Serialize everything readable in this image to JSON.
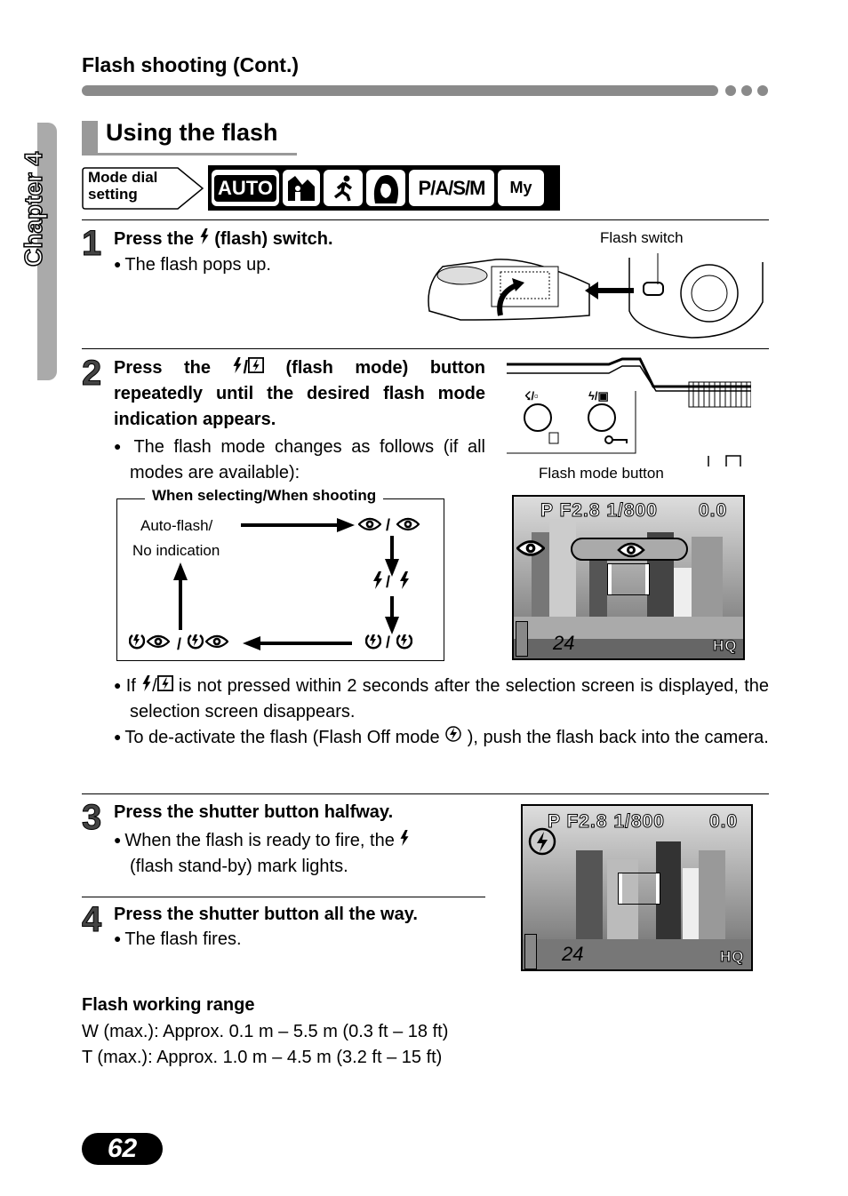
{
  "header": {
    "title": "Flash shooting (Cont.)"
  },
  "chapter": {
    "label": "Chapter 4"
  },
  "section": {
    "title": "Using the flash"
  },
  "mode_dial": {
    "label": "Mode dial setting",
    "modes": [
      "AUTO",
      "landscape-portrait-icon",
      "sports-icon",
      "portrait-icon",
      "P/A/S/M",
      "My"
    ]
  },
  "steps": [
    {
      "num": "1",
      "title_pre": "Press the",
      "title_post": "(flash) switch.",
      "bullets": [
        "The flash pops up."
      ],
      "figure_label": "Flash switch"
    },
    {
      "num": "2",
      "title_pre": "Press the",
      "title_post": "(flash mode) button repeatedly until the desired flash mode indication appears.",
      "bullets": [
        "The flash mode changes as follows (if all modes are available):"
      ],
      "figure_label": "Flash mode button"
    },
    {
      "num": "3",
      "title": "Press the shutter button halfway.",
      "bullets": [
        "When the flash is ready to fire, the",
        "(flash stand-by) mark lights."
      ]
    },
    {
      "num": "4",
      "title": "Press the shutter button all the way.",
      "bullets": [
        "The flash fires."
      ]
    }
  ],
  "cycle": {
    "title": "When selecting/When shooting",
    "auto": "Auto-flash/",
    "no_ind": "No indication"
  },
  "notes": [
    {
      "pre": "If",
      "post": "is not pressed within 2 seconds after the selection screen is displayed, the selection screen disappears."
    },
    {
      "pre": "To de-activate the flash (Flash Off mode",
      "post": "), push the flash back into the camera."
    }
  ],
  "lcd": {
    "mode": "P",
    "aperture": "F2.8",
    "shutter": "1/800",
    "ev": "0.0",
    "count": "24",
    "quality": "HQ"
  },
  "range": {
    "title": "Flash working range",
    "w": "W (max.): Approx. 0.1 m – 5.5 m (0.3 ft – 18 ft)",
    "t": "T (max.): Approx. 1.0 m – 4.5 m (3.2 ft – 15 ft)"
  },
  "page": {
    "number": "62"
  }
}
